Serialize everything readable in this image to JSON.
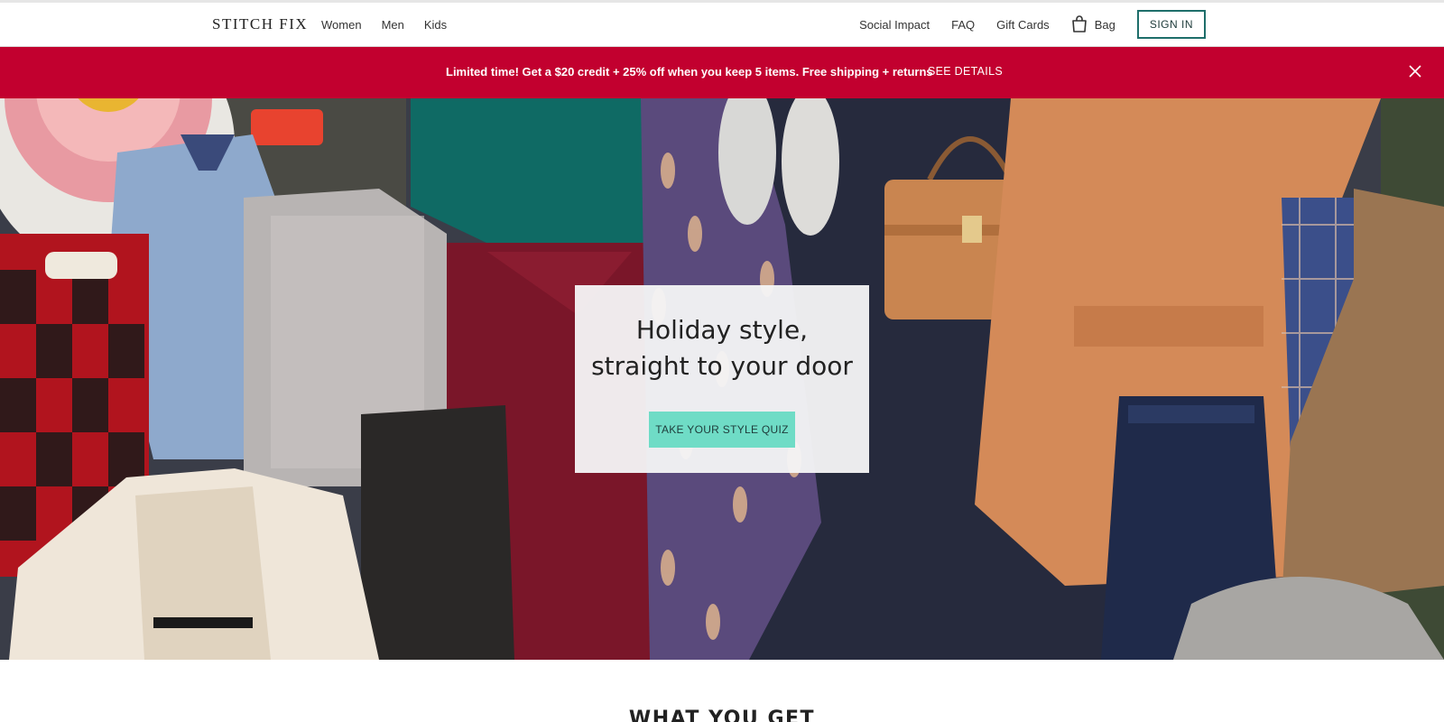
{
  "header": {
    "logo": "STITCH FIX",
    "nav_left": [
      "Women",
      "Men",
      "Kids"
    ],
    "nav_right": {
      "social_impact": "Social Impact",
      "faq": "FAQ",
      "gift_cards": "Gift Cards",
      "bag": "Bag",
      "sign_in": "SIGN IN"
    }
  },
  "promo": {
    "text": "Limited time! Get a $20 credit + 25% off when you keep 5 items. Free shipping + returns",
    "link": "SEE DETAILS",
    "close_icon": "close-icon",
    "background": "#c2002f"
  },
  "hero": {
    "title_line1": "Holiday style,",
    "title_line2": "straight to your door",
    "cta": "TAKE YOUR STYLE QUIZ",
    "cta_color": "#6fdcc6"
  },
  "section": {
    "heading": "WHAT YOU GET"
  },
  "colors": {
    "brand_teal": "#1e6e6a",
    "accent_mint": "#6fdcc6",
    "promo_red": "#c2002f"
  }
}
